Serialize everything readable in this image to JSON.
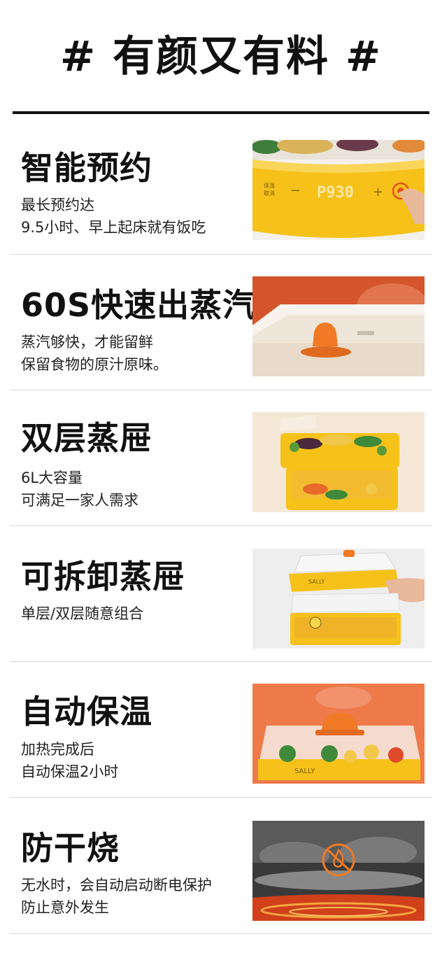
{
  "header": {
    "title": "# 有颜又有料 #"
  },
  "features": [
    {
      "title": "智能预约",
      "lines": [
        "最长预约达",
        "9.5小时、早上起床就有饭吃"
      ],
      "display": "P930",
      "panel_label_1": "保温",
      "panel_label_2": "取消"
    },
    {
      "title": "60S快速出蒸汽",
      "lines": [
        "蒸汽够快，才能留鲜",
        "保留食物的原汁原味。"
      ]
    },
    {
      "title": "双层蒸屉",
      "lines": [
        "6L大容量",
        "可满足一家人需求"
      ]
    },
    {
      "title": "可拆卸蒸屉",
      "lines": [
        "单层/双层随意组合"
      ],
      "brand": "SALLY"
    },
    {
      "title": "自动保温",
      "lines": [
        "加热完成后",
        "自动保温2小时"
      ],
      "brand": "SALLY"
    },
    {
      "title": "防干烧",
      "lines": [
        "无水时，会自动启动断电保护",
        "防止意外发生"
      ]
    }
  ],
  "colors": {
    "accent_yellow": "#f6c21a",
    "accent_orange": "#e8643a",
    "text": "#111111"
  }
}
